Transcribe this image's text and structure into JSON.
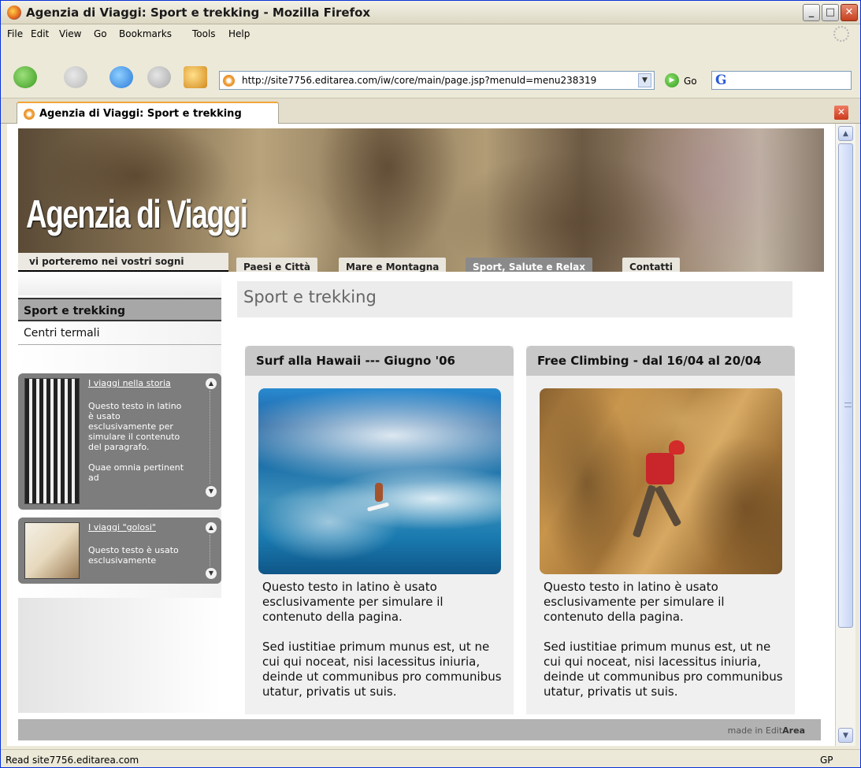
{
  "window": {
    "title": "Agenzia di Viaggi: Sport e trekking - Mozilla Firefox",
    "min": "_",
    "max": "□",
    "close": "✕"
  },
  "menubar": {
    "items": [
      "File",
      "Edit",
      "View",
      "Go",
      "Bookmarks",
      "Tools",
      "Help"
    ]
  },
  "toolbar": {
    "url": "http://site7756.editarea.com/iw/core/main/page.jsp?menuId=menu238319",
    "go_label": "Go",
    "icons": [
      "back-icon",
      "forward-icon",
      "reload-icon",
      "stop-icon",
      "home-icon"
    ]
  },
  "tab": {
    "label": "Agenzia di Viaggi: Sport e trekking"
  },
  "page": {
    "logo": "Agenzia di Viaggi",
    "slogan": "vi porteremo nei vostri sogni",
    "nav": [
      "Paesi e Città",
      "Mare e Montagna",
      "Sport, Salute e Relax",
      "Contatti"
    ],
    "nav_active": "Sport, Salute e Relax",
    "sidebar": {
      "items": [
        "Sport e trekking",
        "Centri termali"
      ],
      "box1": {
        "title": "I viaggi nella storia",
        "text": "Questo testo in latino è usato esclusivamente per simulare il contenuto del paragrafo.\n\nQuae omnia pertinent ad"
      },
      "box2": {
        "title": "I viaggi \"golosi\"",
        "text": "Questo testo è usato esclusivamente"
      }
    },
    "title": "Sport e trekking",
    "cards": [
      {
        "title": "Surf alla Hawaii --- Giugno '06",
        "text": "Questo testo in latino è usato esclusivamente per simulare il contenuto della pagina.\n\nSed iustitiae primum munus est, ut ne cui qui noceat, nisi lacessitus iniuria, deinde ut communibus pro communibus utatur, privatis ut suis."
      },
      {
        "title": "Free Climbing - dal 16/04 al 20/04",
        "text": "Questo testo in latino è usato esclusivamente per simulare il contenuto della pagina.\n\nSed iustitiae primum munus est, ut ne cui qui noceat, nisi lacessitus iniuria, deinde ut communibus pro communibus utatur, privatis ut suis."
      }
    ],
    "footer_prefix": "made in Edit",
    "footer_brand": "Area"
  },
  "status": {
    "text": "Read site7756.editarea.com",
    "right": "GP"
  }
}
